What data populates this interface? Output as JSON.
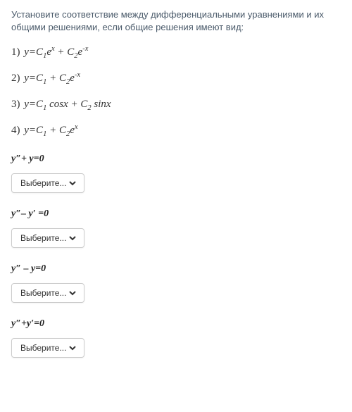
{
  "prompt": "Установите соответствие между дифференциальными уравнениями и их общими решениями, если общие решения имеют вид:",
  "equations": {
    "e1": {
      "num": "1)"
    },
    "e2": {
      "num": "2)"
    },
    "e3": {
      "num": "3)"
    },
    "e4": {
      "num": "4)"
    }
  },
  "questions": {
    "q1": {
      "label": "y″+ y=0"
    },
    "q2": {
      "label": "y″– y′ =0"
    },
    "q3": {
      "label": "y″ – y=0"
    },
    "q4": {
      "label": "y″+y′=0"
    }
  },
  "select_placeholder": "Выберите...",
  "math": {
    "y": "y",
    "eq": "=",
    "plus": " + ",
    "C": "C",
    "one": "1",
    "two": "2",
    "e": "e",
    "x": "x",
    "negx": "-x",
    "cosx": " cosx ",
    "sinx": " sinx"
  }
}
